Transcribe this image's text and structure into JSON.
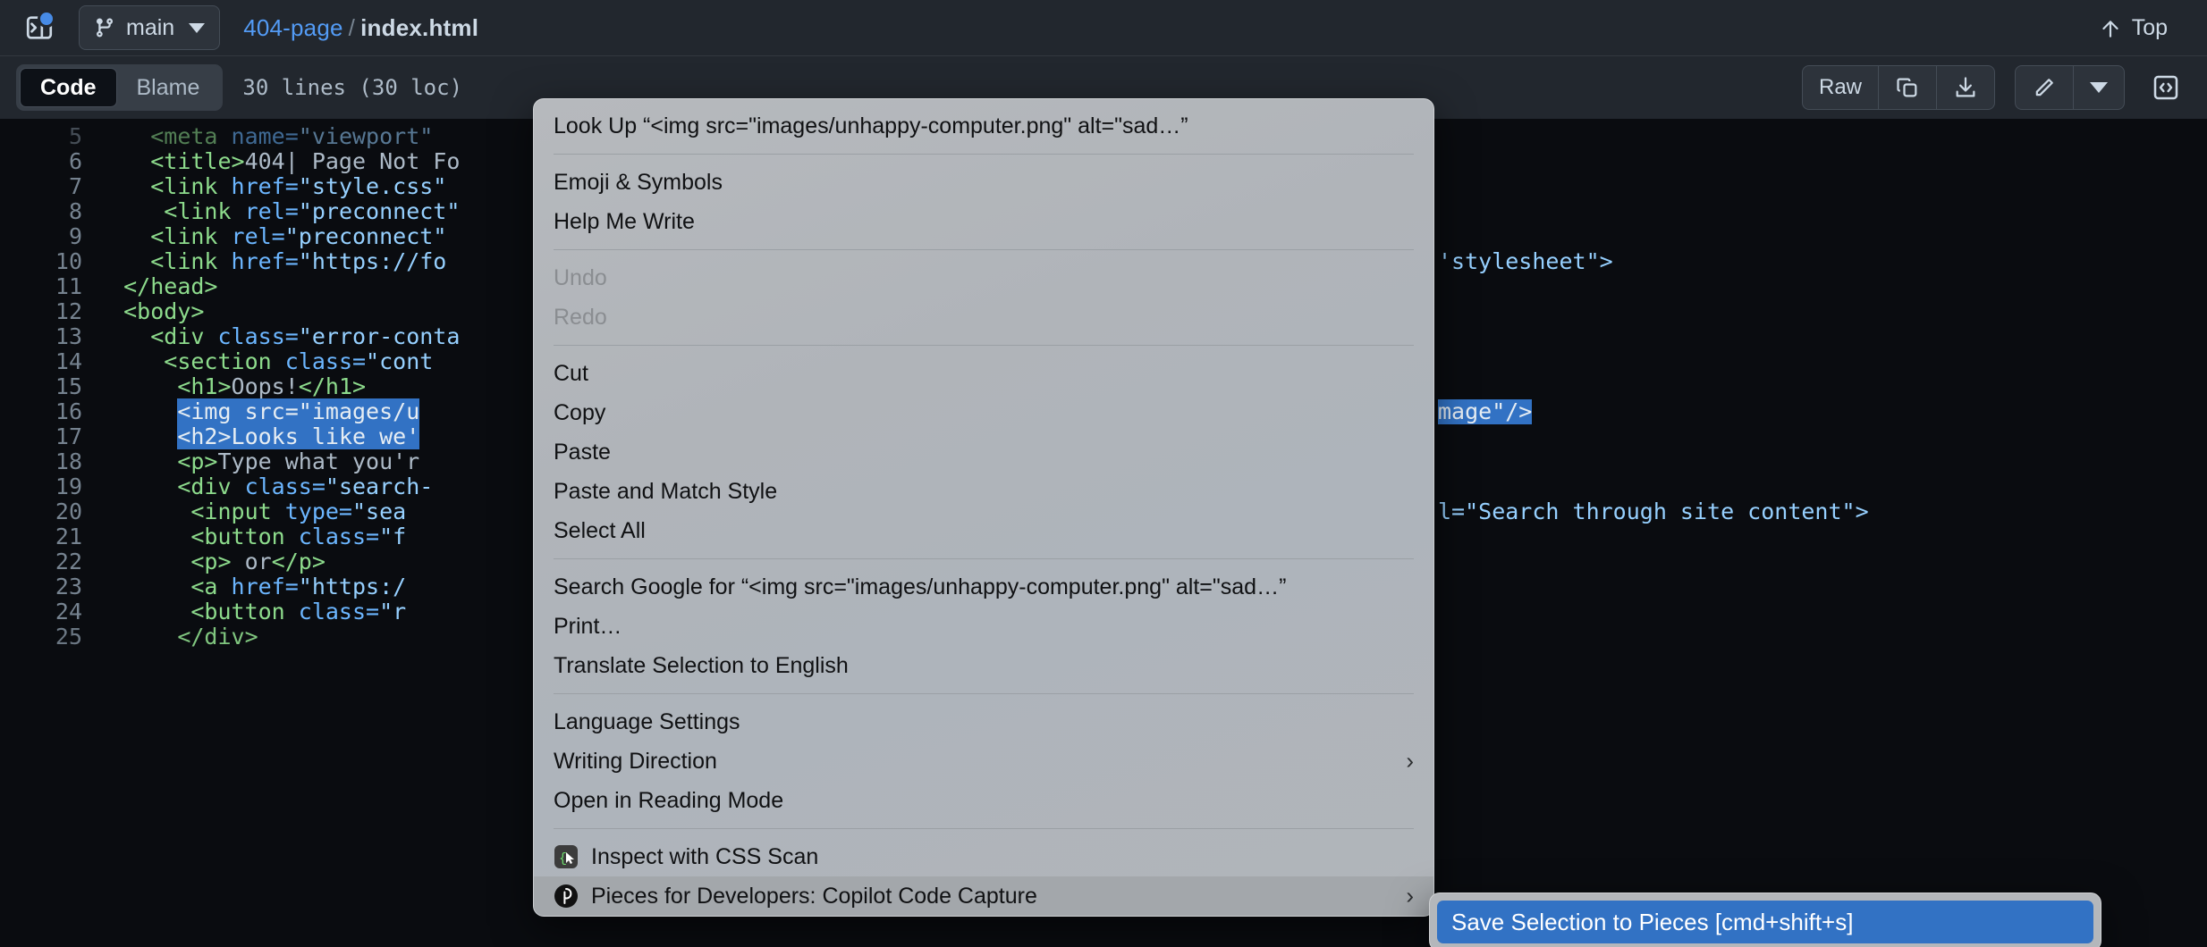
{
  "topbar": {
    "sidebar_toggle_icon": "sidebar-expand-icon",
    "notification_dot": true,
    "branch": {
      "icon": "git-branch-icon",
      "name": "main",
      "caret_icon": "chevron-down-icon"
    },
    "breadcrumb": {
      "repo": "404-page",
      "separator": "/",
      "file": "index.html"
    },
    "top_button": {
      "icon": "arrow-up-icon",
      "label": "Top"
    }
  },
  "codehead": {
    "tabs": [
      {
        "label": "Code",
        "active": true
      },
      {
        "label": "Blame",
        "active": false
      }
    ],
    "loc": "30 lines (30 loc)",
    "raw_label": "Raw",
    "copy_icon": "copy-icon",
    "download_icon": "download-icon",
    "edit_icon": "pencil-icon",
    "edit_caret_icon": "chevron-down-icon",
    "symbols_icon": "code-brackets-icon"
  },
  "code": {
    "lines": [
      {
        "n": "5",
        "partial": true,
        "segments": [
          {
            "t": "    ",
            "c": "txt"
          },
          {
            "t": "<meta ",
            "c": "tag"
          },
          {
            "t": "name=",
            "c": "attr"
          },
          {
            "t": "\"viewport\"",
            "c": "str"
          }
        ]
      },
      {
        "n": "6",
        "segments": [
          {
            "t": "    ",
            "c": "txt"
          },
          {
            "t": "<title>",
            "c": "tag"
          },
          {
            "t": "404| Page Not Fo",
            "c": "txt"
          }
        ]
      },
      {
        "n": "7",
        "segments": [
          {
            "t": "    ",
            "c": "txt"
          },
          {
            "t": "<link ",
            "c": "tag"
          },
          {
            "t": "href=",
            "c": "attr"
          },
          {
            "t": "\"style.css\"",
            "c": "str"
          }
        ]
      },
      {
        "n": "8",
        "segments": [
          {
            "t": "     ",
            "c": "txt"
          },
          {
            "t": "<link ",
            "c": "tag"
          },
          {
            "t": "rel=",
            "c": "attr"
          },
          {
            "t": "\"preconnect\"",
            "c": "str"
          }
        ]
      },
      {
        "n": "9",
        "segments": [
          {
            "t": "    ",
            "c": "txt"
          },
          {
            "t": "<link ",
            "c": "tag"
          },
          {
            "t": "rel=",
            "c": "attr"
          },
          {
            "t": "\"preconnect\"",
            "c": "str"
          }
        ]
      },
      {
        "n": "10",
        "segments": [
          {
            "t": "    ",
            "c": "txt"
          },
          {
            "t": "<link ",
            "c": "tag"
          },
          {
            "t": "href=",
            "c": "attr"
          },
          {
            "t": "\"https://fo",
            "c": "str"
          }
        ],
        "tail": {
          "t": "'stylesheet\">",
          "c": "str"
        }
      },
      {
        "n": "11",
        "segments": [
          {
            "t": "  ",
            "c": "txt"
          },
          {
            "t": "</head>",
            "c": "tag"
          }
        ]
      },
      {
        "n": "12",
        "segments": [
          {
            "t": "  ",
            "c": "txt"
          },
          {
            "t": "<body>",
            "c": "tag"
          }
        ]
      },
      {
        "n": "13",
        "segments": [
          {
            "t": "    ",
            "c": "txt"
          },
          {
            "t": "<div ",
            "c": "tag"
          },
          {
            "t": "class=",
            "c": "attr"
          },
          {
            "t": "\"error-conta",
            "c": "str"
          }
        ]
      },
      {
        "n": "14",
        "segments": [
          {
            "t": "     ",
            "c": "txt"
          },
          {
            "t": "<section ",
            "c": "tag"
          },
          {
            "t": "class=",
            "c": "attr"
          },
          {
            "t": "\"cont",
            "c": "str"
          }
        ]
      },
      {
        "n": "15",
        "segments": [
          {
            "t": "      ",
            "c": "txt"
          },
          {
            "t": "<h1>",
            "c": "tag"
          },
          {
            "t": "Oops!",
            "c": "txt"
          },
          {
            "t": "</h1>",
            "c": "tag"
          }
        ]
      },
      {
        "n": "16",
        "selected": true,
        "sel_start": 6,
        "segments": [
          {
            "t": "      ",
            "c": "txt"
          },
          {
            "t": "<img ",
            "c": "tag"
          },
          {
            "t": "src=",
            "c": "attr"
          },
          {
            "t": "\"images/u",
            "c": "str"
          }
        ],
        "tail": {
          "t": "mage\"/>",
          "c": "str",
          "selected": true
        }
      },
      {
        "n": "17",
        "selected": true,
        "sel_start": 4,
        "segments": [
          {
            "t": "      ",
            "c": "txt"
          },
          {
            "t": "<h2>",
            "c": "tag"
          },
          {
            "t": "Looks like we'",
            "c": "txt"
          }
        ]
      },
      {
        "n": "18",
        "segments": [
          {
            "t": "      ",
            "c": "txt"
          },
          {
            "t": "<p>",
            "c": "tag"
          },
          {
            "t": "Type what you'r",
            "c": "txt"
          }
        ]
      },
      {
        "n": "19",
        "segments": [
          {
            "t": "      ",
            "c": "txt"
          },
          {
            "t": "<div ",
            "c": "tag"
          },
          {
            "t": "class=",
            "c": "attr"
          },
          {
            "t": "\"search-",
            "c": "str"
          }
        ]
      },
      {
        "n": "20",
        "segments": [
          {
            "t": "       ",
            "c": "txt"
          },
          {
            "t": "<input ",
            "c": "tag"
          },
          {
            "t": "type=",
            "c": "attr"
          },
          {
            "t": "\"sea",
            "c": "str"
          }
        ],
        "tail": {
          "t": "l=\"Search through site content\">",
          "c": "str"
        }
      },
      {
        "n": "21",
        "segments": [
          {
            "t": "       ",
            "c": "txt"
          },
          {
            "t": "<button ",
            "c": "tag"
          },
          {
            "t": "class=",
            "c": "attr"
          },
          {
            "t": "\"f",
            "c": "str"
          }
        ]
      },
      {
        "n": "22",
        "segments": [
          {
            "t": "       ",
            "c": "txt"
          },
          {
            "t": "<p>",
            "c": "tag"
          },
          {
            "t": " or",
            "c": "txt"
          },
          {
            "t": "</p>",
            "c": "tag"
          }
        ]
      },
      {
        "n": "23",
        "segments": [
          {
            "t": "       ",
            "c": "txt"
          },
          {
            "t": "<a ",
            "c": "tag"
          },
          {
            "t": "href=",
            "c": "attr"
          },
          {
            "t": "\"https:/",
            "c": "str"
          }
        ]
      },
      {
        "n": "24",
        "segments": [
          {
            "t": "       ",
            "c": "txt"
          },
          {
            "t": "<button ",
            "c": "tag"
          },
          {
            "t": "class=",
            "c": "attr"
          },
          {
            "t": "\"r",
            "c": "str"
          }
        ]
      },
      {
        "n": "25",
        "partial_bottom": true,
        "segments": [
          {
            "t": "      ",
            "c": "txt"
          },
          {
            "t": "</div>",
            "c": "tag"
          }
        ]
      }
    ]
  },
  "context_menu": {
    "items": [
      {
        "label": "Look Up “<img src=\"images/unhappy-computer.png\" alt=\"sad…”",
        "kind": "item"
      },
      {
        "kind": "separator"
      },
      {
        "label": "Emoji & Symbols",
        "kind": "item"
      },
      {
        "label": "Help Me Write",
        "kind": "item"
      },
      {
        "kind": "separator"
      },
      {
        "label": "Undo",
        "kind": "item",
        "disabled": true
      },
      {
        "label": "Redo",
        "kind": "item",
        "disabled": true
      },
      {
        "kind": "separator"
      },
      {
        "label": "Cut",
        "kind": "item"
      },
      {
        "label": "Copy",
        "kind": "item"
      },
      {
        "label": "Paste",
        "kind": "item"
      },
      {
        "label": "Paste and Match Style",
        "kind": "item"
      },
      {
        "label": "Select All",
        "kind": "item"
      },
      {
        "kind": "separator"
      },
      {
        "label": "Search Google for “<img src=\"images/unhappy-computer.png\" alt=\"sad…”",
        "kind": "item"
      },
      {
        "label": "Print…",
        "kind": "item"
      },
      {
        "label": "Translate Selection to English",
        "kind": "item"
      },
      {
        "kind": "separator"
      },
      {
        "label": "Language Settings",
        "kind": "item"
      },
      {
        "label": "Writing Direction",
        "kind": "item",
        "submenu": true
      },
      {
        "label": "Open in Reading Mode",
        "kind": "item"
      },
      {
        "kind": "separator"
      },
      {
        "label": "Inspect with CSS Scan",
        "kind": "item",
        "icon": "css-scan-icon"
      },
      {
        "label": "Pieces for Developers: Copilot  Code Capture",
        "kind": "item",
        "icon": "pieces-icon",
        "submenu": true,
        "highlighted": true
      }
    ],
    "submenu_arrow": "›"
  },
  "submenu": {
    "items": [
      {
        "label": "Save Selection to Pieces [cmd+shift+s]",
        "highlighted": true
      }
    ]
  },
  "colors": {
    "accent_blue": "#3272c4",
    "link_blue": "#539bf5",
    "menu_bg": "#b4b7bb",
    "code_bg": "#0a0c10",
    "chrome_bg": "#22272e"
  }
}
